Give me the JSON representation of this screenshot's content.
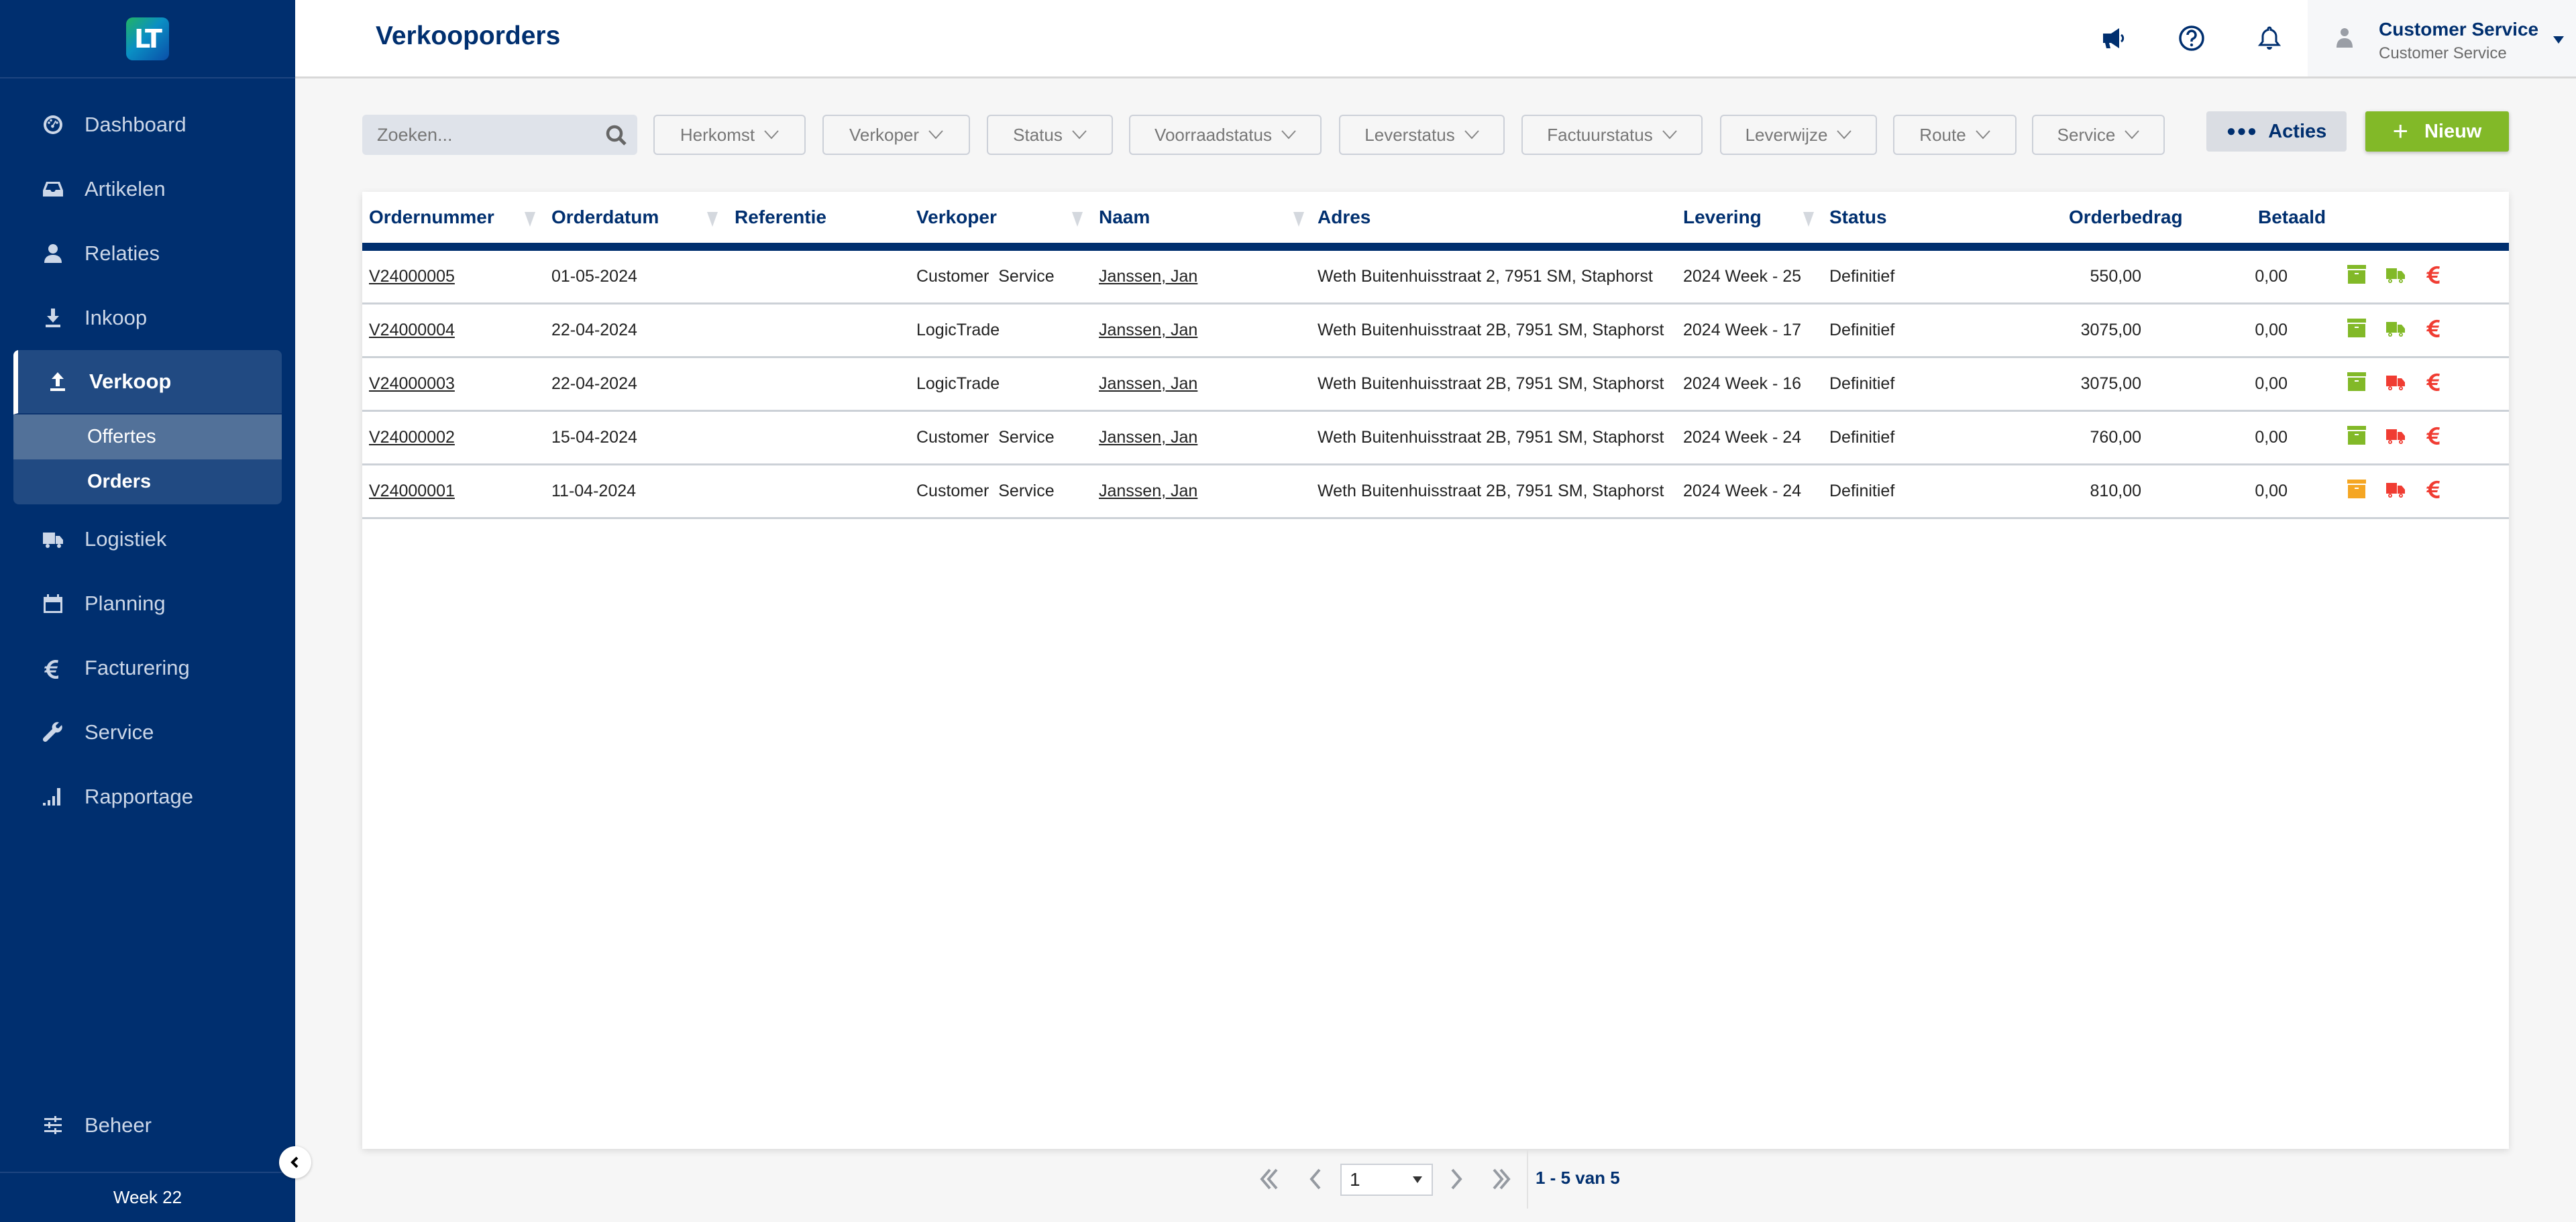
{
  "app": {
    "logo_text": "LT"
  },
  "sidebar": {
    "items": [
      {
        "label": "Dashboard",
        "icon": "dashboard-icon"
      },
      {
        "label": "Artikelen",
        "icon": "inbox-icon"
      },
      {
        "label": "Relaties",
        "icon": "user-icon"
      },
      {
        "label": "Inkoop",
        "icon": "download-icon"
      },
      {
        "label": "Verkoop",
        "icon": "upload-icon",
        "active": true,
        "children": [
          {
            "label": "Offertes"
          },
          {
            "label": "Orders",
            "current": true
          }
        ]
      },
      {
        "label": "Logistiek",
        "icon": "truck-icon"
      },
      {
        "label": "Planning",
        "icon": "calendar-icon"
      },
      {
        "label": "Facturering",
        "icon": "euro-icon"
      },
      {
        "label": "Service",
        "icon": "wrench-icon"
      },
      {
        "label": "Rapportage",
        "icon": "signal-bars-icon"
      }
    ],
    "bottom_item": {
      "label": "Beheer",
      "icon": "sliders-icon"
    },
    "week_label": "Week 22"
  },
  "header": {
    "title": "Verkooporders",
    "icons": [
      "megaphone-icon",
      "help-icon",
      "bell-icon"
    ],
    "user": {
      "name": "Customer Service",
      "role": "Customer Service"
    }
  },
  "toolbar": {
    "search_placeholder": "Zoeken...",
    "filters": [
      "Herkomst",
      "Verkoper",
      "Status",
      "Voorraadstatus",
      "Leverstatus",
      "Factuurstatus",
      "Leverwijze",
      "Route",
      "Service"
    ],
    "acties_label": "Acties",
    "nieuw_label": "Nieuw"
  },
  "table": {
    "columns": [
      "Ordernummer",
      "Orderdatum",
      "Referentie",
      "Verkoper",
      "Naam",
      "Adres",
      "Levering",
      "Status",
      "Orderbedrag",
      "Betaald"
    ],
    "rows": [
      {
        "ordernummer": "V24000005",
        "orderdatum": "01-05-2024",
        "referentie": "",
        "verkoper": "Customer  Service",
        "naam": "Janssen, Jan",
        "adres": "Weth Buitenhuisstraat 2, 7951 SM, Staphorst",
        "levering": "2024 Week - 25",
        "status": "Definitief",
        "orderbedrag": "550,00",
        "betaald": "0,00",
        "stock_status": "green",
        "delivery_status": "green",
        "invoice_status": "red"
      },
      {
        "ordernummer": "V24000004",
        "orderdatum": "22-04-2024",
        "referentie": "",
        "verkoper": "LogicTrade",
        "naam": "Janssen, Jan",
        "adres": "Weth Buitenhuisstraat 2B, 7951 SM, Staphorst",
        "levering": "2024 Week - 17",
        "status": "Definitief",
        "orderbedrag": "3075,00",
        "betaald": "0,00",
        "stock_status": "green",
        "delivery_status": "green",
        "invoice_status": "red"
      },
      {
        "ordernummer": "V24000003",
        "orderdatum": "22-04-2024",
        "referentie": "",
        "verkoper": "LogicTrade",
        "naam": "Janssen, Jan",
        "adres": "Weth Buitenhuisstraat 2B, 7951 SM, Staphorst",
        "levering": "2024 Week - 16",
        "status": "Definitief",
        "orderbedrag": "3075,00",
        "betaald": "0,00",
        "stock_status": "green",
        "delivery_status": "red",
        "invoice_status": "red"
      },
      {
        "ordernummer": "V24000002",
        "orderdatum": "15-04-2024",
        "referentie": "",
        "verkoper": "Customer  Service",
        "naam": "Janssen, Jan",
        "adres": "Weth Buitenhuisstraat 2B, 7951 SM, Staphorst",
        "levering": "2024 Week - 24",
        "status": "Definitief",
        "orderbedrag": "760,00",
        "betaald": "0,00",
        "stock_status": "green",
        "delivery_status": "red",
        "invoice_status": "red"
      },
      {
        "ordernummer": "V24000001",
        "orderdatum": "11-04-2024",
        "referentie": "",
        "verkoper": "Customer  Service",
        "naam": "Janssen, Jan",
        "adres": "Weth Buitenhuisstraat 2B, 7951 SM, Staphorst",
        "levering": "2024 Week - 24",
        "status": "Definitief",
        "orderbedrag": "810,00",
        "betaald": "0,00",
        "stock_status": "orange",
        "delivery_status": "red",
        "invoice_status": "red"
      }
    ]
  },
  "pagination": {
    "current_page": "1",
    "info": "1 - 5 van 5"
  },
  "colors": {
    "brand": "#002f6f",
    "green": "#82b928",
    "orange": "#f5a623",
    "red": "#f03c32"
  }
}
